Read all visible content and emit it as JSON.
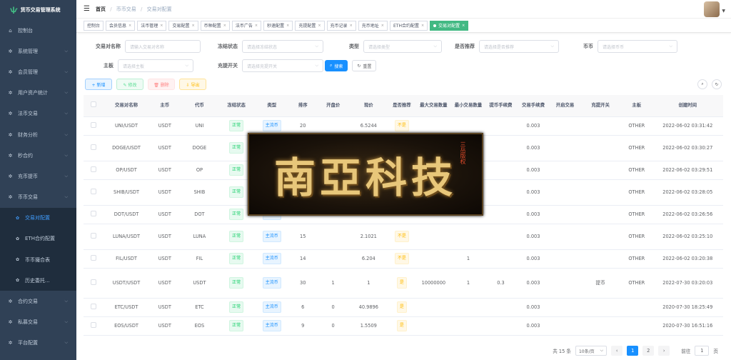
{
  "sidebar": {
    "brand": "货币交易管理系统",
    "items": [
      {
        "label": "控制台",
        "icon": "dashboard-icon",
        "arrow": false
      },
      {
        "label": "系统管理",
        "icon": "gear-icon",
        "arrow": true
      },
      {
        "label": "会员管理",
        "icon": "gear-icon",
        "arrow": true
      },
      {
        "label": "用户资产统计",
        "icon": "gear-icon",
        "arrow": true
      },
      {
        "label": "法币交易",
        "icon": "gear-icon",
        "arrow": true
      },
      {
        "label": "财务分析",
        "icon": "gear-icon",
        "arrow": true
      },
      {
        "label": "秒合约",
        "icon": "gear-icon",
        "arrow": true
      },
      {
        "label": "充币提币",
        "icon": "gear-icon",
        "arrow": true
      },
      {
        "label": "币币交易",
        "icon": "gear-icon",
        "arrow": true
      }
    ],
    "sub_items": [
      {
        "label": "交易对配置",
        "active": true
      },
      {
        "label": "ETH合约配置",
        "active": false
      },
      {
        "label": "币币撮合表",
        "active": false
      },
      {
        "label": "历史委托...",
        "active": false
      }
    ],
    "items_after": [
      {
        "label": "合约交易",
        "icon": "gear-icon",
        "arrow": true
      },
      {
        "label": "私募交易",
        "icon": "gear-icon",
        "arrow": true
      },
      {
        "label": "平台配置",
        "icon": "gear-icon",
        "arrow": true
      }
    ]
  },
  "header": {
    "breadcrumb": [
      "首页",
      "币币交易",
      "交易对配置"
    ]
  },
  "tags": [
    {
      "label": "控制台",
      "active": false,
      "closable": false
    },
    {
      "label": "会员信息",
      "active": false,
      "closable": true
    },
    {
      "label": "法币管理",
      "active": false,
      "closable": true
    },
    {
      "label": "交易配置",
      "active": false,
      "closable": true
    },
    {
      "label": "币种配置",
      "active": false,
      "closable": true
    },
    {
      "label": "法币广告",
      "active": false,
      "closable": true
    },
    {
      "label": "秒速配置",
      "active": false,
      "closable": true
    },
    {
      "label": "充提配置",
      "active": false,
      "closable": true
    },
    {
      "label": "充币记录",
      "active": false,
      "closable": true
    },
    {
      "label": "充币地址",
      "active": false,
      "closable": true
    },
    {
      "label": "ETH合约配置",
      "active": false,
      "closable": true
    },
    {
      "label": "交易对配置",
      "active": true,
      "closable": true
    }
  ],
  "filters": {
    "pair_name": {
      "label": "交易对名称",
      "placeholder": "请输入交易对名称"
    },
    "lock_status": {
      "label": "冻结状态",
      "placeholder": "请选择冻结状态"
    },
    "type": {
      "label": "类型",
      "placeholder": "请选择类型"
    },
    "recommend": {
      "label": "是否推荐",
      "placeholder": "请选择是否推荐"
    },
    "coin": {
      "label": "币币",
      "placeholder": "请选择币币"
    },
    "board": {
      "label": "主板",
      "placeholder": "请选择主板"
    },
    "recharge": {
      "label": "充提开关",
      "placeholder": "请选择充提开关"
    },
    "search_label": "搜索",
    "reset_label": "重置"
  },
  "toolbar": {
    "add": "+ 新增",
    "edit": "✎ 修改",
    "delete": "🗑 删除",
    "export": "⇩ 导出"
  },
  "table": {
    "columns": [
      "交易对名称",
      "主币",
      "代币",
      "冻结状态",
      "类型",
      "排序",
      "开盘价",
      "现价",
      "是否推荐",
      "最大交易数量",
      "最小交易数量",
      "提币手续费",
      "交易手续费",
      "开启交易",
      "充提开关",
      "主板",
      "创建时间"
    ],
    "rows": [
      {
        "name": "UNI/USDT",
        "main": "USDT",
        "token": "UNI",
        "status": "正常",
        "type": "主流币",
        "sort": "20",
        "open": "",
        "price": "6.5244",
        "rec": "不是",
        "max": "",
        "min": "",
        "wfee": "",
        "tfee": "0.003",
        "trade": "",
        "recharge": "",
        "board": "OTHER",
        "time": "2022-06-02 03:31:42"
      },
      {
        "name": "DOGE/USDT",
        "main": "USDT",
        "token": "DOGE",
        "status": "正常",
        "type": "主流币",
        "sort": "",
        "open": "",
        "price": "",
        "rec": "",
        "max": "",
        "min": "",
        "wfee": "",
        "tfee": "0.003",
        "trade": "",
        "recharge": "",
        "board": "OTHER",
        "time": "2022-06-02 03:30:27"
      },
      {
        "name": "OP/USDT",
        "main": "USDT",
        "token": "OP",
        "status": "正常",
        "type": "主流币",
        "sort": "",
        "open": "",
        "price": "",
        "rec": "",
        "max": "",
        "min": "",
        "wfee": "",
        "tfee": "0.003",
        "trade": "",
        "recharge": "",
        "board": "OTHER",
        "time": "2022-06-02 03:29:51"
      },
      {
        "name": "SHIB/USDT",
        "main": "USDT",
        "token": "SHIB",
        "status": "正常",
        "type": "主流币",
        "sort": "",
        "open": "",
        "price": "",
        "rec": "",
        "max": "",
        "min": "",
        "wfee": "",
        "tfee": "0.003",
        "trade": "",
        "recharge": "",
        "board": "OTHER",
        "time": "2022-06-02 03:28:05"
      },
      {
        "name": "DOT/USDT",
        "main": "USDT",
        "token": "DOT",
        "status": "正常",
        "type": "主流币",
        "sort": "",
        "open": "",
        "price": "",
        "rec": "",
        "max": "",
        "min": "",
        "wfee": "",
        "tfee": "0.003",
        "trade": "",
        "recharge": "",
        "board": "OTHER",
        "time": "2022-06-02 03:26:56"
      },
      {
        "name": "LUNA/USDT",
        "main": "USDT",
        "token": "LUNA",
        "status": "正常",
        "type": "主流币",
        "sort": "15",
        "open": "",
        "price": "2.1021",
        "rec": "不是",
        "max": "",
        "min": "",
        "wfee": "",
        "tfee": "0.003",
        "trade": "",
        "recharge": "",
        "board": "OTHER",
        "time": "2022-06-02 03:25:10"
      },
      {
        "name": "FIL/USDT",
        "main": "USDT",
        "token": "FIL",
        "status": "正常",
        "type": "主流币",
        "sort": "14",
        "open": "",
        "price": "6.204",
        "rec": "不是",
        "max": "",
        "min": "1",
        "wfee": "",
        "tfee": "0.003",
        "trade": "",
        "recharge": "",
        "board": "OTHER",
        "time": "2022-06-02 03:20:38"
      },
      {
        "name": "USDT/USDT",
        "main": "USDT",
        "token": "USDT",
        "status": "正常",
        "type": "主流币",
        "sort": "30",
        "open": "1",
        "price": "1",
        "rec": "是",
        "max": "10000000",
        "min": "1",
        "wfee": "0.3",
        "tfee": "0.003",
        "trade": "",
        "recharge": "提币",
        "board": "OTHER",
        "time": "2022-07-30 03:20:03"
      },
      {
        "name": "ETC/USDT",
        "main": "USDT",
        "token": "ETC",
        "status": "正常",
        "type": "主流币",
        "sort": "6",
        "open": "0",
        "price": "40.9896",
        "rec": "是",
        "max": "",
        "min": "",
        "wfee": "",
        "tfee": "0.003",
        "trade": "",
        "recharge": "",
        "board": "",
        "time": "2020-07-30 18:25:49"
      },
      {
        "name": "EOS/USDT",
        "main": "USDT",
        "token": "EOS",
        "status": "正常",
        "type": "主流币",
        "sort": "9",
        "open": "0",
        "price": "1.5509",
        "rec": "是",
        "max": "",
        "min": "",
        "wfee": "",
        "tfee": "0.003",
        "trade": "",
        "recharge": "",
        "board": "",
        "time": "2020-07-30 16:51:16"
      }
    ]
  },
  "pagination": {
    "total": "共 15 条",
    "page_size": "10条/页",
    "pages": [
      "1",
      "2"
    ],
    "current": "1",
    "goto_label": "前往",
    "goto_value": "1",
    "page_unit": "页"
  },
  "watermark": {
    "text": "南亞科技",
    "sub": "三岳版权"
  }
}
